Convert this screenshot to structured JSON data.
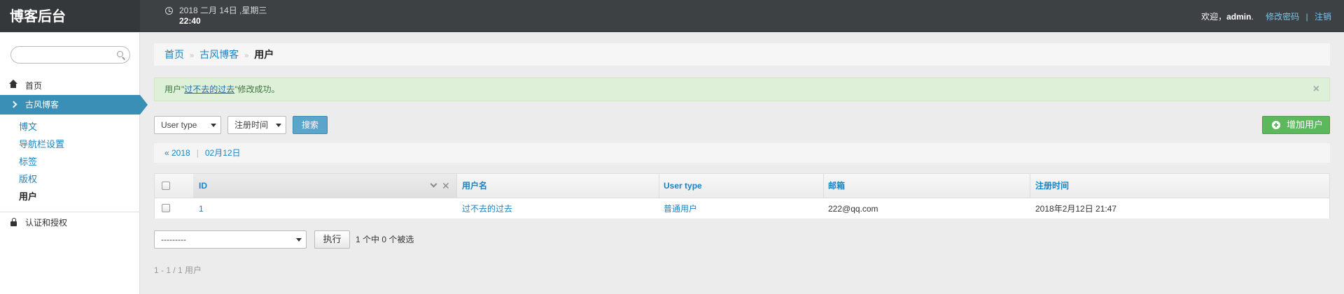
{
  "header": {
    "brand": "博客后台",
    "date": "2018 二月 14日 ,星期三",
    "time": "22:40",
    "welcome": "欢迎，",
    "username": "admin",
    "username_suffix": ".",
    "change_password": "修改密码",
    "logout": "注销"
  },
  "sidebar": {
    "search_placeholder": "",
    "home": "首页",
    "active_app": "古风博客",
    "items": [
      "博文",
      "导航栏设置",
      "标签",
      "版权",
      "用户"
    ],
    "current_item": "用户",
    "auth": "认证和授权"
  },
  "breadcrumb": {
    "home": "首页",
    "app": "古风博客",
    "current": "用户"
  },
  "alert": {
    "prefix": "用户\"",
    "link": "过不去的过去",
    "suffix": "\"修改成功。"
  },
  "filters": {
    "user_type": "User type",
    "register_time": "注册时间",
    "search_button": "搜索",
    "add_button": "增加用户"
  },
  "date_hierarchy": {
    "back": "« 2018",
    "current": "02月12日"
  },
  "table": {
    "columns": [
      "ID",
      "用户名",
      "User type",
      "邮箱",
      "注册时间"
    ],
    "rows": [
      {
        "id": "1",
        "username": "过不去的过去",
        "user_type": "普通用户",
        "email": "222@qq.com",
        "registered": "2018年2月12日 21:47"
      }
    ]
  },
  "actions": {
    "selected": "---------",
    "go_button": "执行",
    "counter": "1 个中 0 个被选"
  },
  "paginator": "1 - 1  /  1 用户",
  "colors": {
    "header_bg": "#3d4144",
    "link": "#1a83c2",
    "active_nav": "#3a8fb6",
    "success_bg": "#dff0d8",
    "add_button": "#5cb85c",
    "search_button": "#5ba5cc"
  }
}
